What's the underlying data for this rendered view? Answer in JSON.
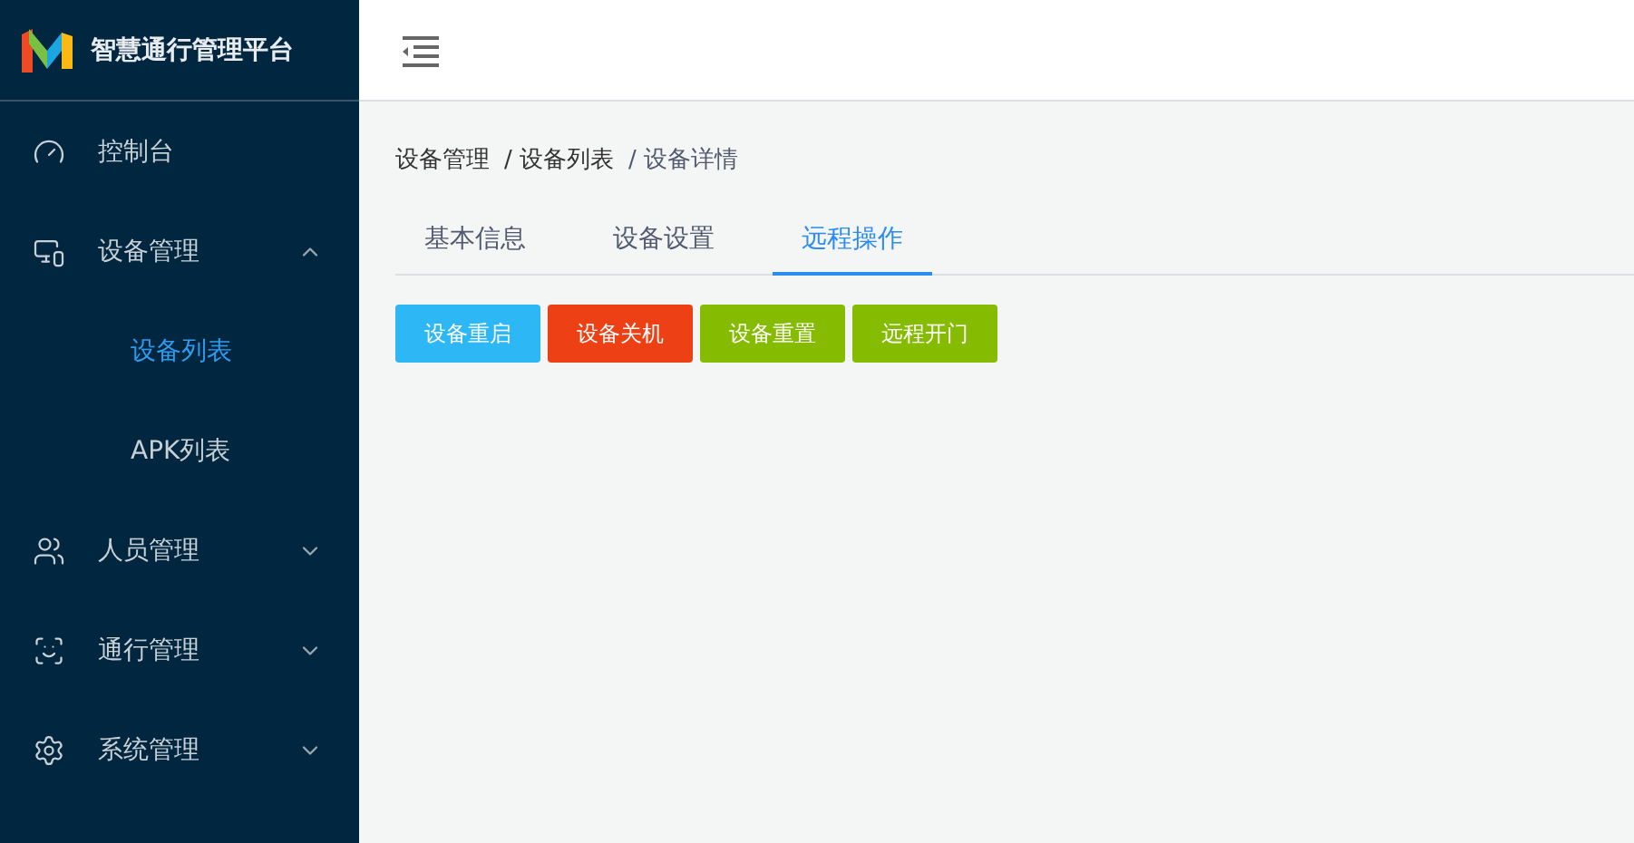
{
  "brand": {
    "title": "智慧通行管理平台"
  },
  "menu": [
    {
      "label": "控制台",
      "kind": "link"
    },
    {
      "label": "设备管理",
      "kind": "group",
      "expanded": true,
      "children": [
        {
          "label": "设备列表",
          "selected": true
        },
        {
          "label": "APK列表",
          "selected": false
        }
      ]
    },
    {
      "label": "人员管理",
      "kind": "group",
      "expanded": false
    },
    {
      "label": "通行管理",
      "kind": "group",
      "expanded": false
    },
    {
      "label": "系统管理",
      "kind": "group",
      "expanded": false
    }
  ],
  "breadcrumb": [
    "设备管理",
    "/ 设备列表",
    "/ 设备详情"
  ],
  "tabs": [
    {
      "label": "基本信息",
      "selected": false
    },
    {
      "label": "设备设置",
      "selected": false
    },
    {
      "label": "远程操作",
      "selected": true
    }
  ],
  "actions": [
    {
      "label": "设备重启",
      "color": "#2db7f5"
    },
    {
      "label": "设备关机",
      "color": "#ed4014"
    },
    {
      "label": "设备重置",
      "color": "#85bb00"
    },
    {
      "label": "远程开门",
      "color": "#85bb00"
    }
  ]
}
